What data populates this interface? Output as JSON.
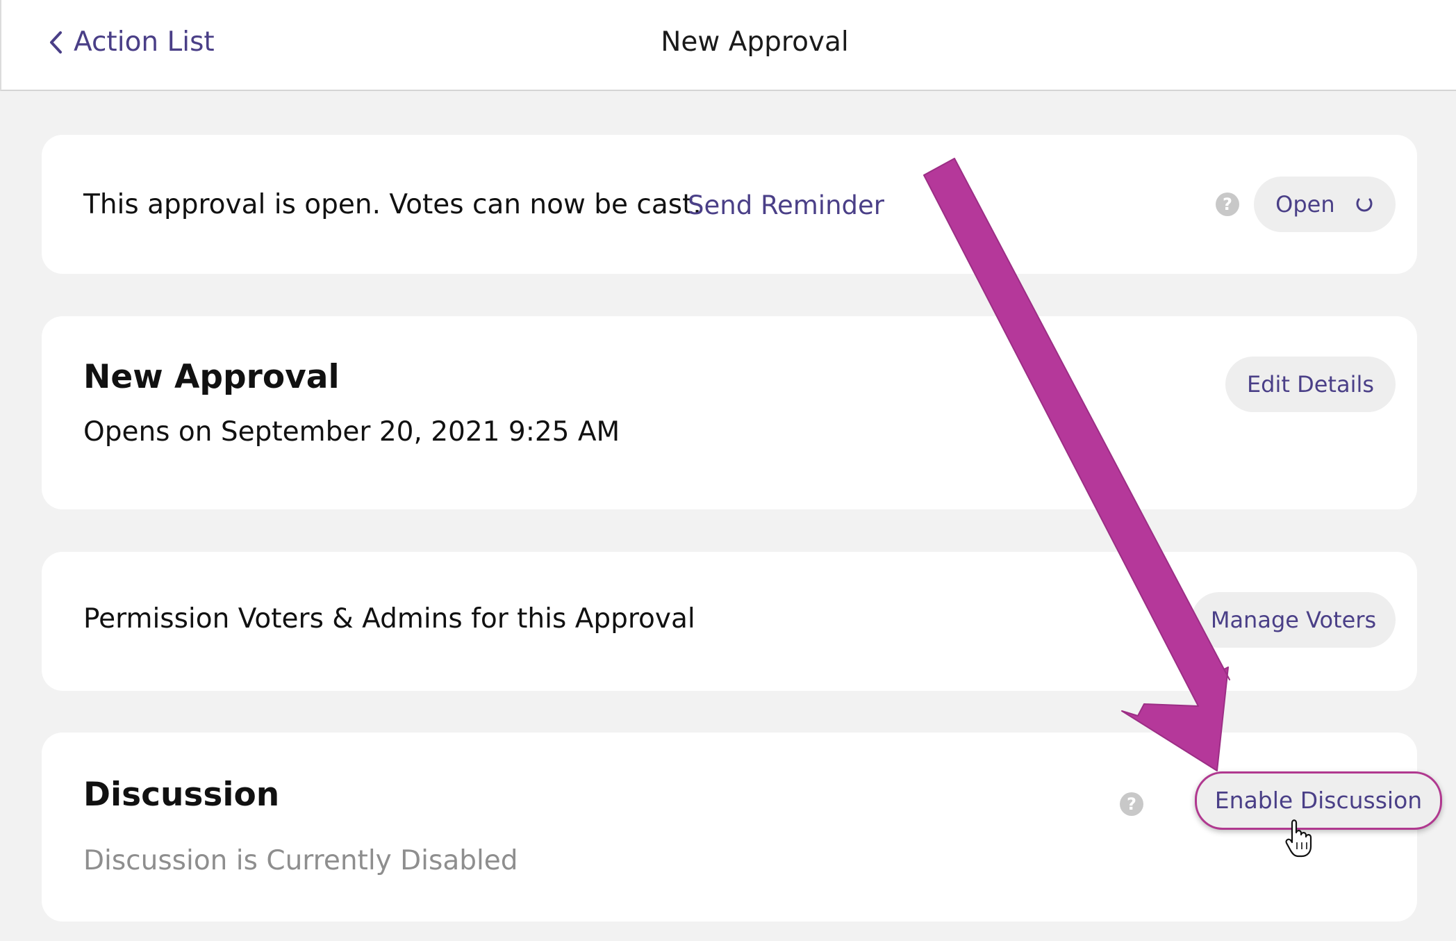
{
  "header": {
    "back_label": "Action List",
    "title": "New Approval"
  },
  "status_card": {
    "text": "This approval is open. Votes can now be cast.",
    "reminder_link": "Send Reminder",
    "help_symbol": "?",
    "status_button": "Open"
  },
  "details_card": {
    "title": "New Approval",
    "opens_text": "Opens on September 20, 2021 9:25 AM",
    "edit_button": "Edit Details"
  },
  "voters_card": {
    "text": "Permission Voters & Admins for this Approval",
    "manage_button": "Manage Voters"
  },
  "discussion_card": {
    "title": "Discussion",
    "status_text": "Discussion is Currently Disabled",
    "help_symbol": "?",
    "enable_button": "Enable Discussion"
  },
  "colors": {
    "accent": "#4a3f87",
    "annotation_arrow": "#b5389a",
    "background": "#f2f2f2"
  },
  "icons": {
    "back": "chevron-left-icon",
    "help": "question-circle-icon",
    "status": "spinner-icon",
    "cursor": "hand-pointer-icon",
    "annotation": "arrow-icon"
  }
}
